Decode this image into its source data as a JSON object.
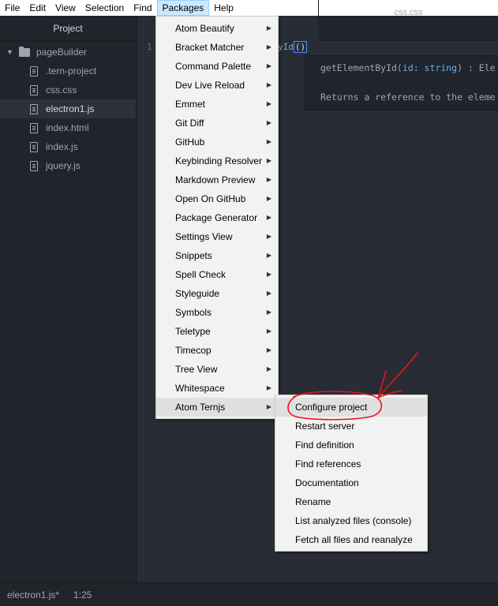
{
  "menubar": {
    "items": [
      "File",
      "Edit",
      "View",
      "Selection",
      "Find",
      "Packages",
      "Help"
    ],
    "active": "Packages"
  },
  "sidebar": {
    "title": "Project",
    "root": "pageBuilder",
    "files": [
      ".tern-project",
      "css.css",
      "electron1.js",
      "index.html",
      "index.js",
      "jquery.js"
    ],
    "selected": "electron1.js"
  },
  "editor": {
    "tab_inactive": "css.css",
    "line_number": "1",
    "code_visible": "yId",
    "code_cursor": "()"
  },
  "tooltip": {
    "signature_name": "getElementById(",
    "signature_param": "id: string",
    "signature_rest": ") : Ele",
    "doc": "Returns a reference to the eleme"
  },
  "packages_menu": {
    "items": [
      "Atom Beautify",
      "Bracket Matcher",
      "Command Palette",
      "Dev Live Reload",
      "Emmet",
      "Git Diff",
      "GitHub",
      "Keybinding Resolver",
      "Markdown Preview",
      "Open On GitHub",
      "Package Generator",
      "Settings View",
      "Snippets",
      "Spell Check",
      "Styleguide",
      "Symbols",
      "Teletype",
      "Timecop",
      "Tree View",
      "Whitespace",
      "Atom Ternjs"
    ],
    "highlighted": "Atom Ternjs"
  },
  "ternjs_submenu": {
    "items": [
      "Configure project",
      "Restart server",
      "Find definition",
      "Find references",
      "Documentation",
      "Rename",
      "List analyzed files (console)",
      "Fetch all files and reanalyze"
    ],
    "highlighted": "Configure project"
  },
  "statusbar": {
    "file": "electron1.js*",
    "position": "1:25"
  },
  "colors": {
    "annotation": "#e8141b",
    "accent": "#61afef"
  }
}
